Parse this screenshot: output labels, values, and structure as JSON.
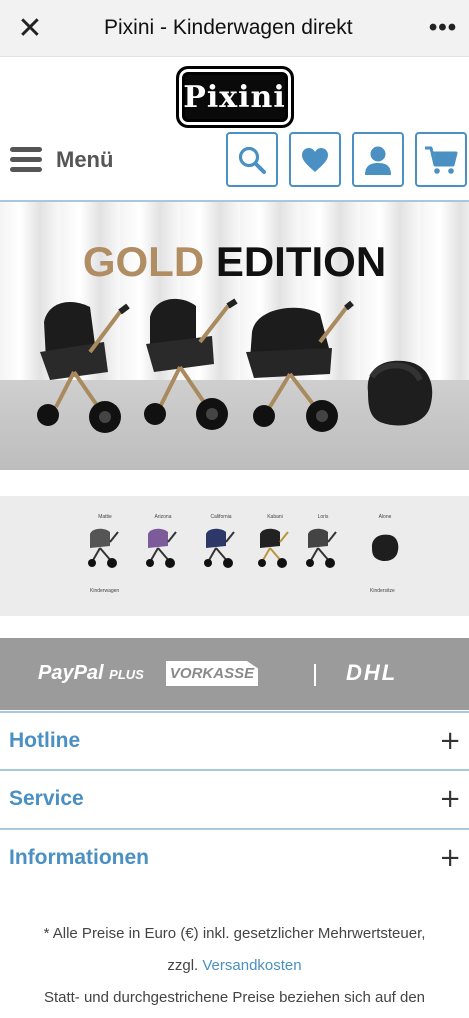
{
  "browser": {
    "close_icon": "close-icon",
    "title": "Pixini - Kinderwagen direkt",
    "more_icon": "more-icon"
  },
  "logo": {
    "text": "Pixini"
  },
  "nav": {
    "menu_label": "Menü",
    "icons": [
      "search-icon",
      "heart-icon",
      "user-icon",
      "cart-icon"
    ],
    "accent_color": "#4a90c2"
  },
  "hero": {
    "title_gold": "GOLD",
    "title_black": "EDITION",
    "gold_color": "#b08d62"
  },
  "thumbnails": {
    "items": [
      "Mattie",
      "Arizona",
      "California",
      "Kabani",
      "Loris",
      "Alone"
    ],
    "caption_left": "Kinderwagen",
    "caption_right": "Kindersitze"
  },
  "payments": {
    "paypal": "PayPal",
    "paypal_plus": "PLUS",
    "vorkasse": "VORKASSE",
    "dhl": "DHL"
  },
  "accordion": [
    {
      "label": "Hotline"
    },
    {
      "label": "Service"
    },
    {
      "label": "Informationen"
    }
  ],
  "footer": {
    "line1": "* Alle Preise in Euro (€) inkl. gesetzlicher Mehrwertsteuer,",
    "line2_prefix": "zzgl.",
    "line2_link": "Versandkosten",
    "line3": "Statt- und durchgestrichene Preise beziehen sich auf den"
  }
}
